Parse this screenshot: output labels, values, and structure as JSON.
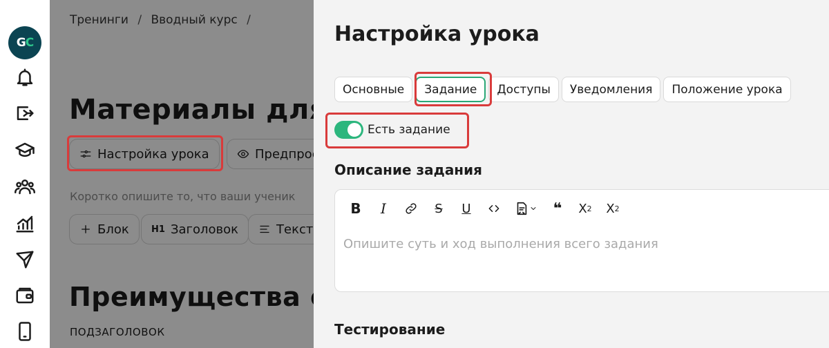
{
  "sidebar": {
    "logo_left": "G",
    "logo_right": "C",
    "icons": [
      "bell-icon",
      "exit-icon",
      "graduation-cap-icon",
      "users-icon",
      "chart-icon",
      "send-icon",
      "wallet-icon",
      "phone-icon"
    ]
  },
  "editor": {
    "breadcrumb": [
      "Тренинги",
      "Вводный курс"
    ],
    "breadcrumb_separator": "/",
    "title": "Материалы для р",
    "lesson_settings_label": "Настройка урока",
    "preview_label": "Предпрос",
    "hint": "Коротко опишите то, что ваши ученик",
    "add_block_label": "Блок",
    "heading_label": "Заголовок",
    "heading_prefix": "H1",
    "text_label": "Текст",
    "section_title": "Преимущества с",
    "subheading": "ПОДЗАГОЛОВОК"
  },
  "panel": {
    "title": "Настройка урока",
    "tabs": [
      {
        "label": "Основные",
        "active": false
      },
      {
        "label": "Задание",
        "active": true
      },
      {
        "label": "Доступы",
        "active": false
      },
      {
        "label": "Уведомления",
        "active": false
      },
      {
        "label": "Положение урока",
        "active": false
      }
    ],
    "has_task_label": "Есть задание",
    "has_task_enabled": true,
    "description_title": "Описание задания",
    "description_placeholder": "Опишите суть и ход выполнения всего задания",
    "testing_title": "Тестирование"
  },
  "colors": {
    "accent_green": "#2cb67d",
    "highlight_red": "#d93b3b",
    "logo_bg": "#0b4452"
  }
}
